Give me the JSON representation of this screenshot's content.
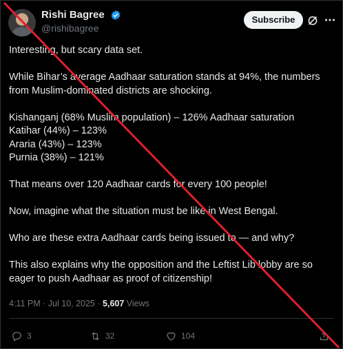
{
  "header": {
    "display_name": "Rishi Bagree",
    "handle": "@rishibagree",
    "subscribe_label": "Subscribe"
  },
  "tweet": {
    "paragraphs": [
      "Interesting, but scary data set.",
      "While Bihar’s average Aadhaar saturation stands at 94%, the numbers from Muslim-dominated districts are shocking.",
      "Kishanganj (68% Muslim population) – 126% Aadhaar saturation",
      "Katihar (44%) – 123%",
      "Araria (43%) – 123%",
      "Purnia (38%) – 121%",
      "That means over 120 Aadhaar cards for every 100 people!",
      "Now, imagine what the situation must be like in West Bengal.",
      "Who are these extra Aadhaar cards being issued to — and why?",
      "This also explains why the opposition and the Leftist Lib lobby are so eager to push Aadhaar as proof of citizenship!"
    ]
  },
  "meta": {
    "time": "4:11 PM",
    "separator": "·",
    "date": "Jul 10, 2025",
    "views_count": "5,607",
    "views_label": "Views"
  },
  "actions": {
    "replies": "3",
    "reposts": "32",
    "likes": "104"
  },
  "colors": {
    "background": "#000000",
    "text": "#e7e9ea",
    "muted": "#71767b",
    "verified": "#1d9bf0",
    "cross_line": "#e0202e"
  },
  "icons": [
    "verified-badge-icon",
    "grok-icon",
    "more-icon",
    "reply-icon",
    "repost-icon",
    "like-icon",
    "share-icon"
  ]
}
